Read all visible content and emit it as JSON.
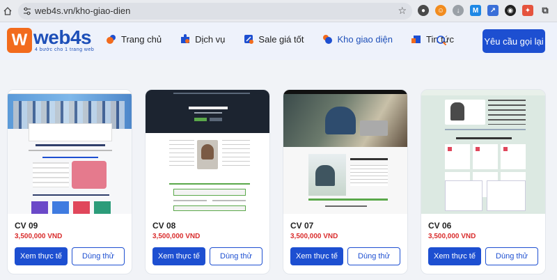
{
  "browser": {
    "url": "web4s.vn/kho-giao-dien"
  },
  "header": {
    "brand": "web4s",
    "tagline": "4 bước cho 1 trang web",
    "nav": [
      {
        "label": "Trang chủ"
      },
      {
        "label": "Dịch vụ"
      },
      {
        "label": "Sale giá tốt"
      },
      {
        "label": "Kho giao diện"
      },
      {
        "label": "Tin tức"
      }
    ],
    "cta": "Yêu cầu gọi lại"
  },
  "colors": {
    "brand_blue": "#1d4fd1",
    "brand_orange": "#f26b1d",
    "price_red": "#d92d2d"
  },
  "cards": [
    {
      "name": "CV 09",
      "price": "3,500,000 VND",
      "primary": "Xem thực tế",
      "secondary": "Dùng thử"
    },
    {
      "name": "CV 08",
      "price": "3,500,000 VND",
      "primary": "Xem thực tế",
      "secondary": "Dùng thử"
    },
    {
      "name": "CV 07",
      "price": "3,500,000 VND",
      "primary": "Xem thực tế",
      "secondary": "Dùng thử"
    },
    {
      "name": "CV 06",
      "price": "3,500,000 VND",
      "primary": "Xem thực tế",
      "secondary": "Dùng thử"
    }
  ]
}
